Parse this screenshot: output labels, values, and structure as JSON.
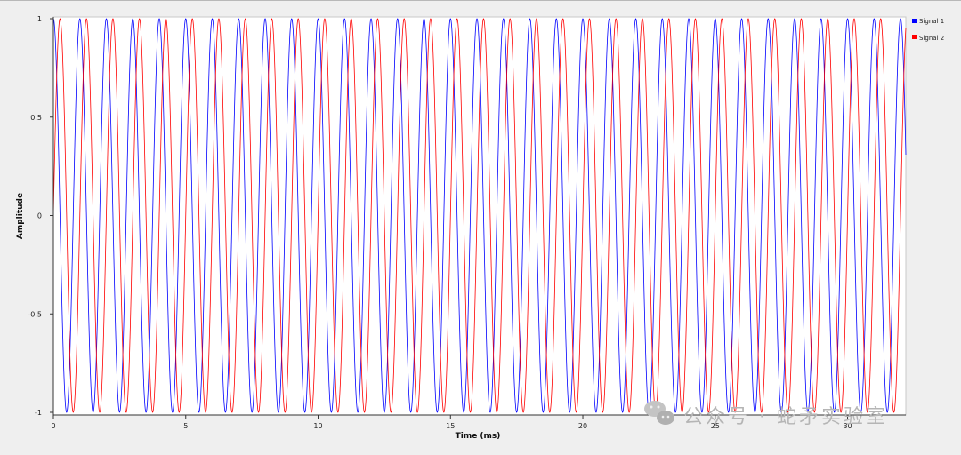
{
  "chart_data": {
    "type": "line",
    "xlabel": "Time (ms)",
    "ylabel": "Amplitude",
    "xlim": [
      0,
      32.2
    ],
    "ylim": [
      -1,
      1
    ],
    "x_ticks": [
      0,
      5,
      10,
      15,
      20,
      25,
      30
    ],
    "y_ticks": [
      1,
      0.5,
      0,
      -0.5,
      -1
    ],
    "x_tick_labels": [
      "0",
      "5",
      "10",
      "15",
      "20",
      "25",
      "30"
    ],
    "y_tick_labels": [
      "1",
      "0.5",
      "0",
      "-0.5",
      "-1"
    ],
    "legend_position": "top-right",
    "grid": false,
    "series": [
      {
        "name": "Signal 1",
        "color": "#0000ff",
        "function": "cos",
        "frequency_khz": 1.0,
        "amplitude": 1
      },
      {
        "name": "Signal 2",
        "color": "#ff0000",
        "function": "sin",
        "frequency_khz": 1.0,
        "amplitude": 1
      }
    ]
  },
  "watermark": {
    "text": "公众号 · 蛇矛实验室",
    "icon": "wechat-icon"
  }
}
